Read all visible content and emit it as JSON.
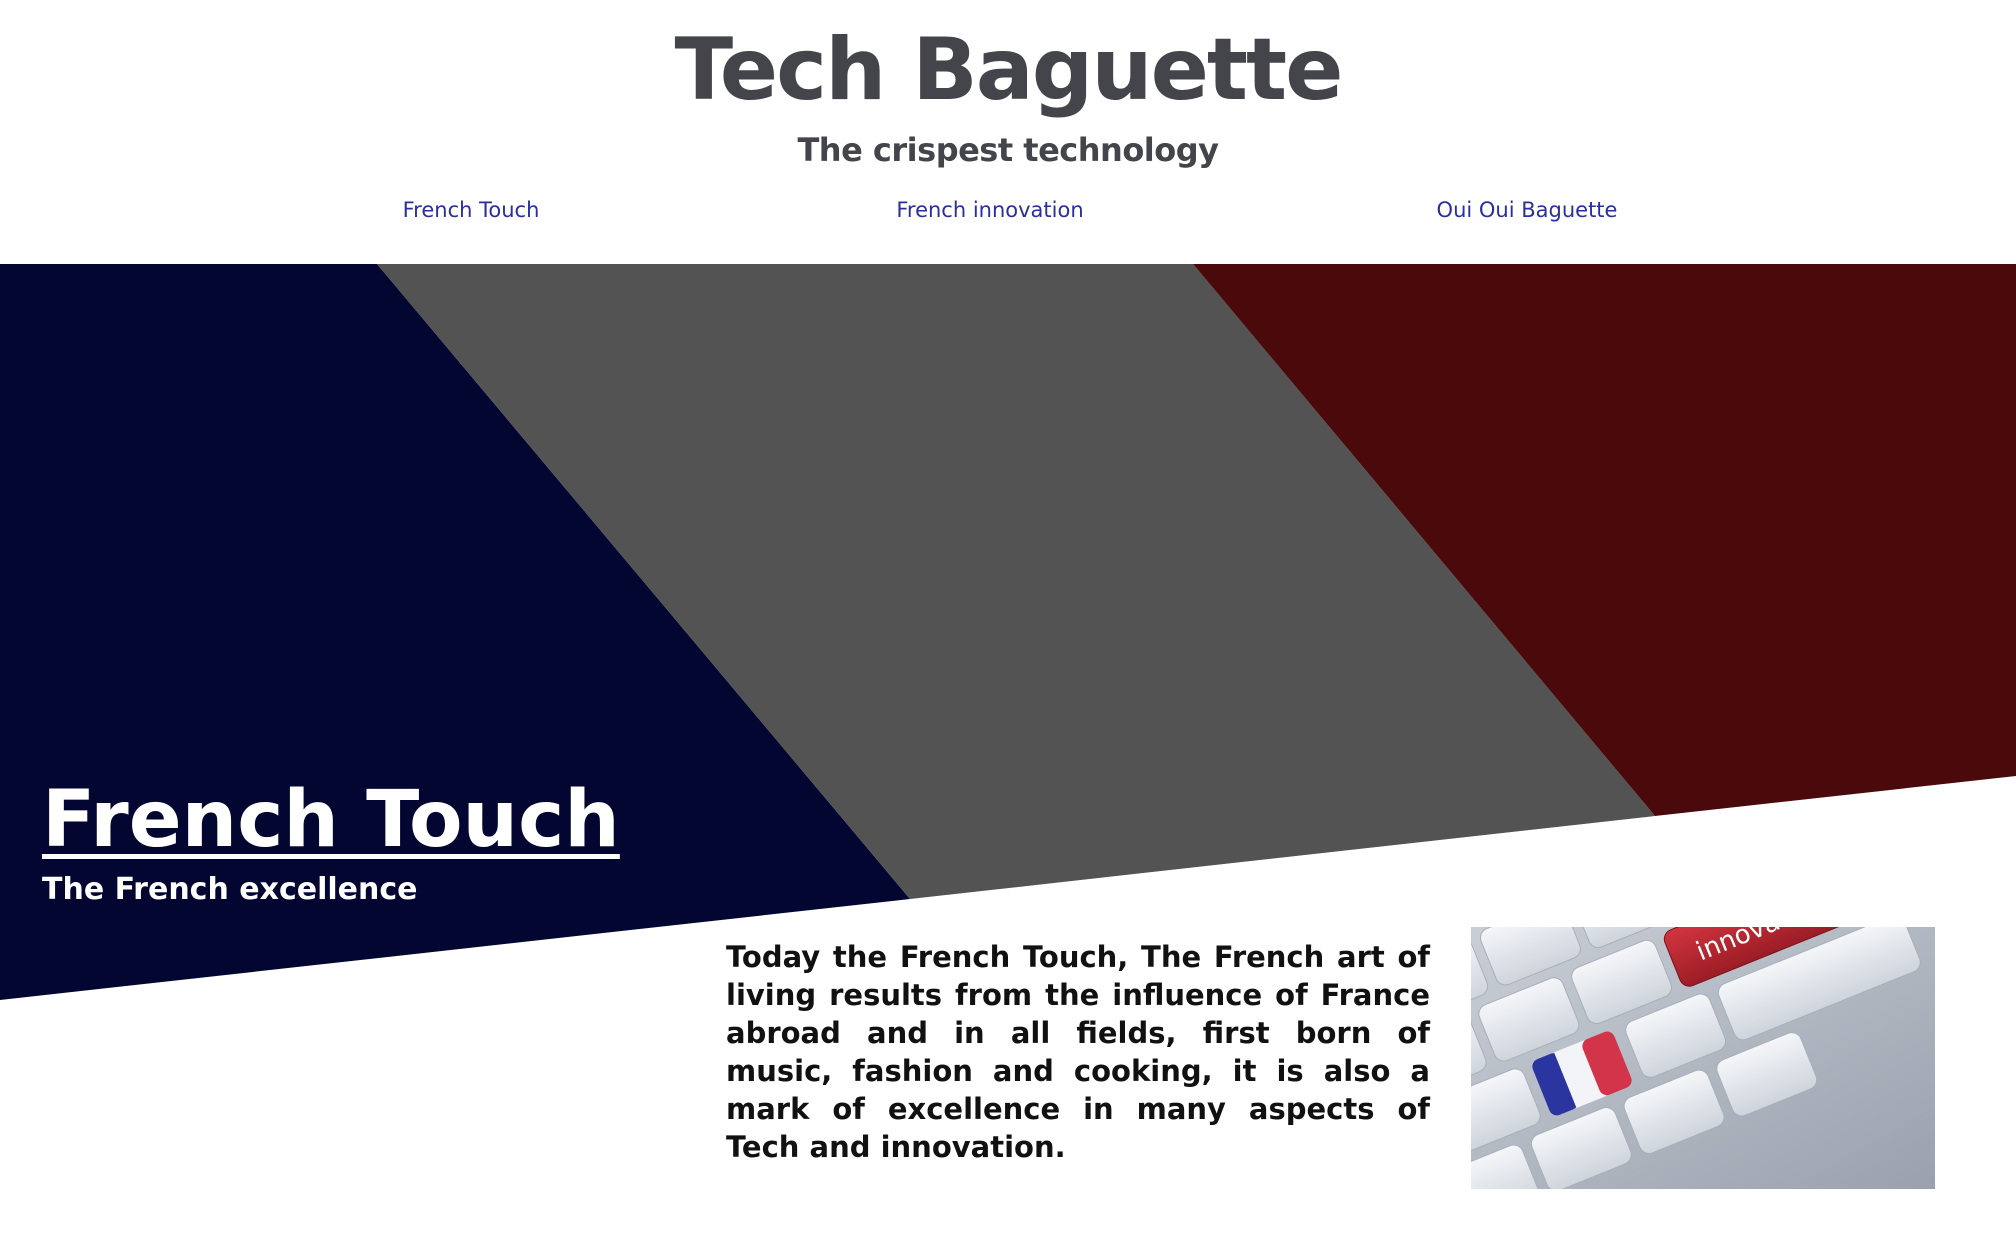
{
  "header": {
    "title": "Tech Baguette",
    "tagline": "The crispest technology"
  },
  "nav": {
    "items": [
      {
        "label": "French Touch"
      },
      {
        "label": "French innovation"
      },
      {
        "label": "Oui Oui Baguette"
      }
    ]
  },
  "hero": {
    "heading": "French Touch",
    "subheading": "The French excellence",
    "intro": "Today the French Touch, The French art of living results from the influence of France abroad and in all fields, first born of music, fashion and cooking, it is also a mark of excellence in many aspects of Tech and innovation.",
    "image": {
      "key_label": "innovation",
      "description_icon": "keyboard-flag-icon"
    }
  },
  "colors": {
    "blue": "#020630",
    "gray": "#535353",
    "red": "#4a0a0c",
    "title": "#44454b",
    "nav_link": "#2a2f9c",
    "background": "#ffffff"
  }
}
